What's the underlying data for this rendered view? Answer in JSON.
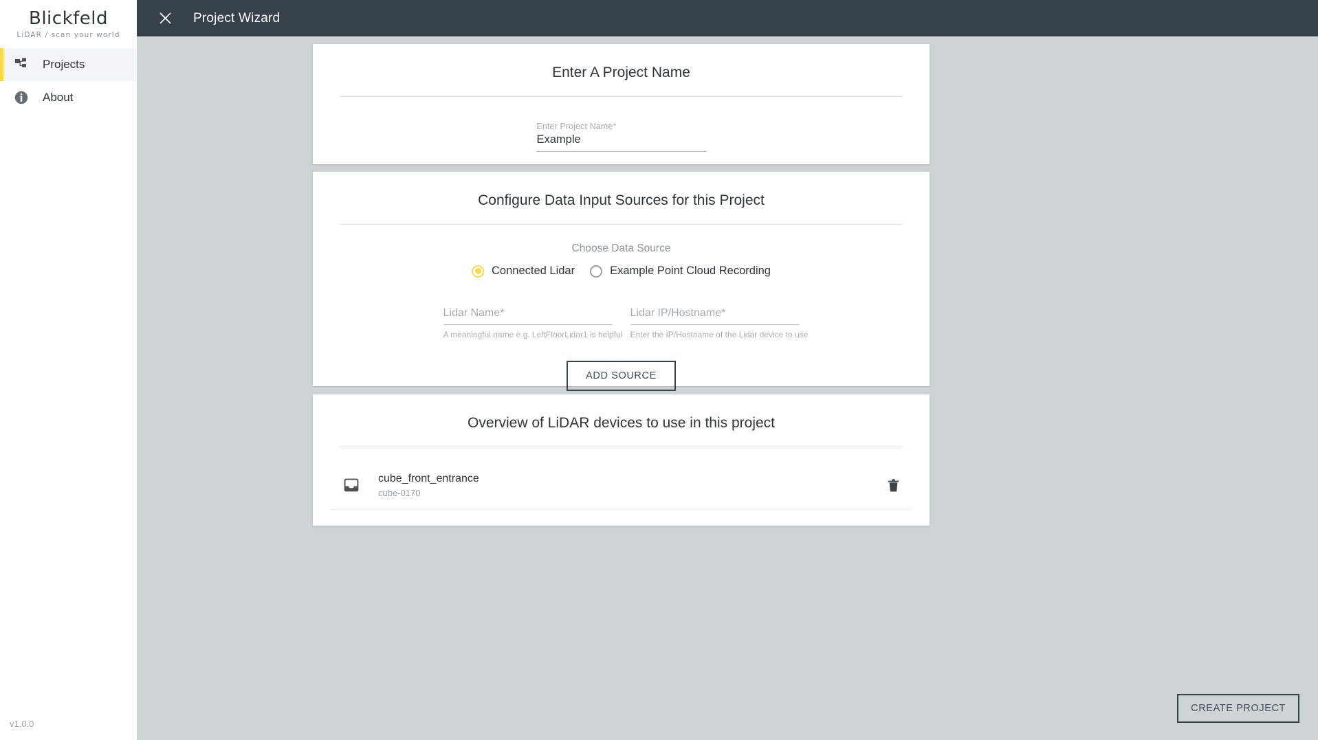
{
  "sidebar": {
    "logo_word": "Blickfeld",
    "logo_tagline": "LiDAR / scan your world",
    "items": [
      {
        "label": "Projects",
        "icon": "sitemap-icon",
        "active": true
      },
      {
        "label": "About",
        "icon": "info-icon",
        "active": false
      }
    ],
    "version": "v1.0.0"
  },
  "topbar": {
    "title": "Project Wizard",
    "close_icon": "close-icon"
  },
  "cards": {
    "project_name": {
      "title": "Enter A Project Name",
      "field": {
        "label": "Enter Project Name*",
        "value": "Example",
        "placeholder": ""
      }
    },
    "data_sources": {
      "title": "Configure Data Input Sources for this Project",
      "choose_label": "Choose Data Source",
      "options": [
        {
          "label": "Connected Lidar",
          "selected": true
        },
        {
          "label": "Example Point Cloud Recording",
          "selected": false
        }
      ],
      "lidar_name": {
        "label": "Lidar Name*",
        "placeholder": "Lidar Name*",
        "value": "",
        "help": "A meaningful name e.g. LeftFloorLidar1 is helpful"
      },
      "lidar_host": {
        "label": "Lidar IP/Hostname*",
        "placeholder": "Lidar IP/Hostname*",
        "value": "",
        "help": "Enter the IP/Hostname of the Lidar device to use"
      },
      "add_source_label": "ADD SOURCE"
    },
    "overview": {
      "title": "Overview of LiDAR devices to use in this project",
      "devices": [
        {
          "name": "cube_front_entrance",
          "serial": "cube-0170",
          "icon": "device-inbox-icon",
          "delete_icon": "trash-icon"
        }
      ]
    }
  },
  "footer": {
    "create_project_label": "CREATE PROJECT"
  },
  "colors": {
    "accent": "#fdd84f",
    "topbar_bg": "#37414a",
    "page_bg": "#ced3d6",
    "card_bg": "#ffffff",
    "text_primary": "#2f3437",
    "text_muted": "#9aa0a6"
  }
}
